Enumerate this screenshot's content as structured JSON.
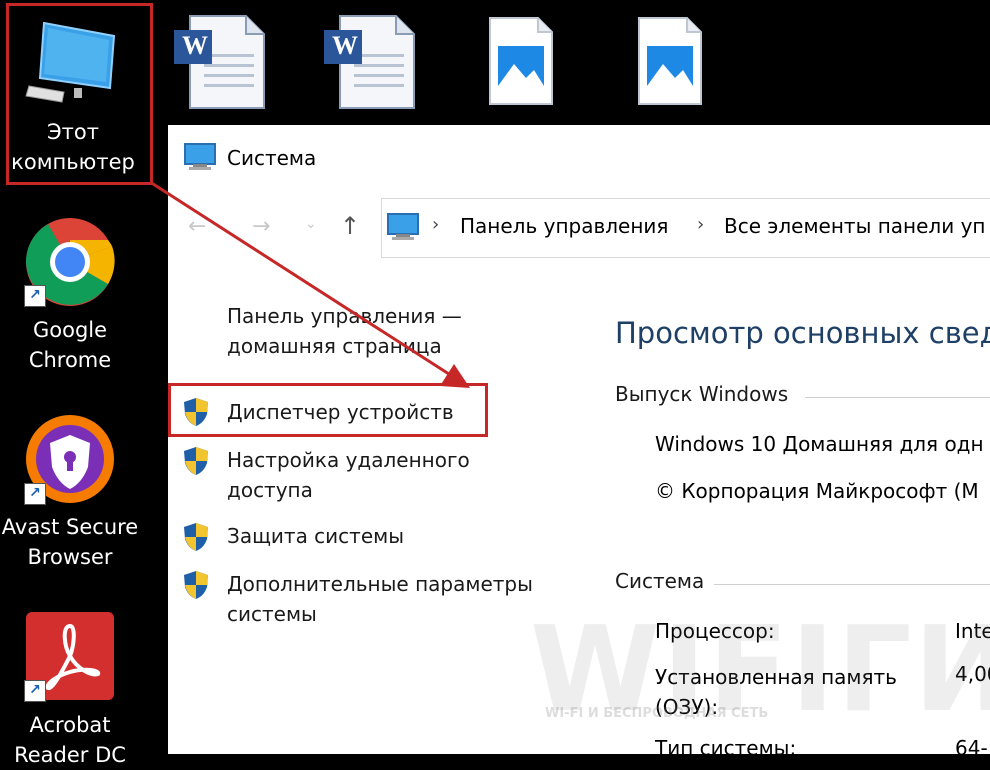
{
  "desktop": {
    "icons": [
      {
        "label_line1": "Этот",
        "label_line2": "компьютер"
      },
      {
        "label_line1": "Google",
        "label_line2": "Chrome"
      },
      {
        "label_line1": "Avast Secure",
        "label_line2": "Browser"
      },
      {
        "label_line1": "Acrobat",
        "label_line2": "Reader DC"
      }
    ],
    "word_glyph": "W"
  },
  "window": {
    "title": "Система",
    "breadcrumb": [
      "Панель управления",
      "Все элементы панели уп"
    ],
    "sidebar": {
      "home_line1": "Панель управления —",
      "home_line2": "домашняя страница",
      "links": [
        {
          "line1": "Диспетчер устройств",
          "line2": ""
        },
        {
          "line1": "Настройка удаленного",
          "line2": "доступа"
        },
        {
          "line1": "Защита системы",
          "line2": ""
        },
        {
          "line1": "Дополнительные параметры",
          "line2": "системы"
        }
      ]
    },
    "main": {
      "heading": "Просмотр основных сведе",
      "edition_section": "Выпуск Windows",
      "edition_name": "Windows 10 Домашняя для одн",
      "copyright": "© Корпорация Майкрософт (М",
      "system_section": "Система",
      "rows": [
        {
          "label": "Процессор:",
          "value": "Inte"
        },
        {
          "label": "Установленная память",
          "label2": "(ОЗУ):",
          "value": "4,00"
        },
        {
          "label": "Тип системы:",
          "value": "64-"
        }
      ]
    }
  },
  "watermark": {
    "main": "WIFIГИД",
    "sub": "WI-FI И БЕСПРОВОДНАЯ СЕТЬ"
  },
  "colors": {
    "annotation": "#c62828",
    "heading": "#1e3f66",
    "desktop": "#000000"
  }
}
